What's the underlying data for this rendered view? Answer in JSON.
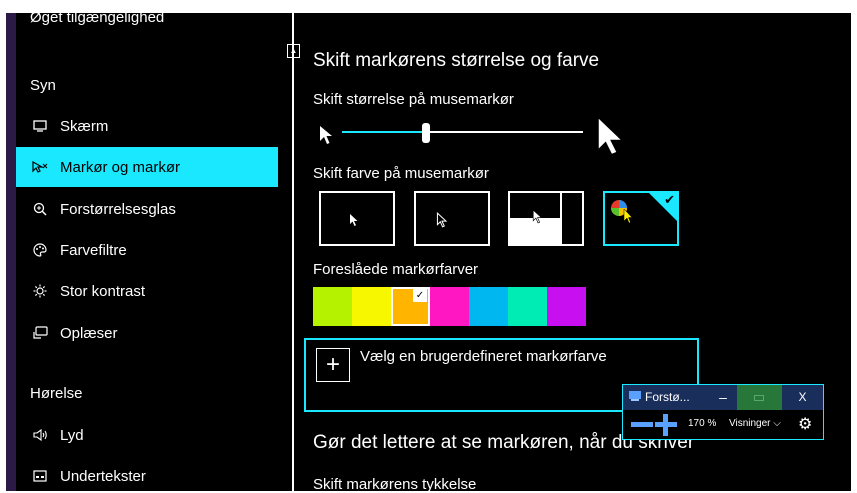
{
  "sidebar": {
    "app_title": "Øget tilgængelighed",
    "section_vision": "Syn",
    "section_hearing": "Hørelse",
    "items": [
      {
        "label": "Skærm",
        "icon": "monitor-icon"
      },
      {
        "label": "Markør og markør",
        "icon": "cursor-pointer-icon",
        "active": true
      },
      {
        "label": "Forstørrelsesglas",
        "icon": "magnifier-icon"
      },
      {
        "label": "Farvefiltre",
        "icon": "palette-icon"
      },
      {
        "label": "Stor kontrast",
        "icon": "sun-icon"
      },
      {
        "label": "Oplæser",
        "icon": "narrator-icon"
      },
      {
        "label": "Lyd",
        "icon": "speaker-icon"
      },
      {
        "label": "Undertekster",
        "icon": "captions-icon"
      }
    ]
  },
  "main": {
    "heading": "Skift markørens størrelse og farve",
    "size_label": "Skift størrelse på musemarkør",
    "size_slider_value": 0.35,
    "color_label": "Skift farve på musemarkør",
    "color_options": [
      "white",
      "black",
      "inverted",
      "custom"
    ],
    "selected_color_option": "custom",
    "suggested_label": "Foreslåede markørfarver",
    "suggested_colors": [
      "#b5f200",
      "#f7f700",
      "#ffb400",
      "#ff17c2",
      "#00b7f0",
      "#00ecb5",
      "#c70ff0"
    ],
    "selected_suggested_index": 2,
    "custom_color_label": "Vælg en brugerdefineret markørfarve",
    "heading2": "Gør det lettere at se markøren, når du skriver",
    "thickness_label": "Skift markørens tykkelse"
  },
  "magnifier": {
    "title": "Forstø...",
    "minimize": "–",
    "close": "X",
    "zoom_level": "170 %",
    "views_label": "Visninger",
    "accent": "#5aa0ff"
  },
  "colors": {
    "accent": "#1ae8ff",
    "background": "#000000"
  }
}
